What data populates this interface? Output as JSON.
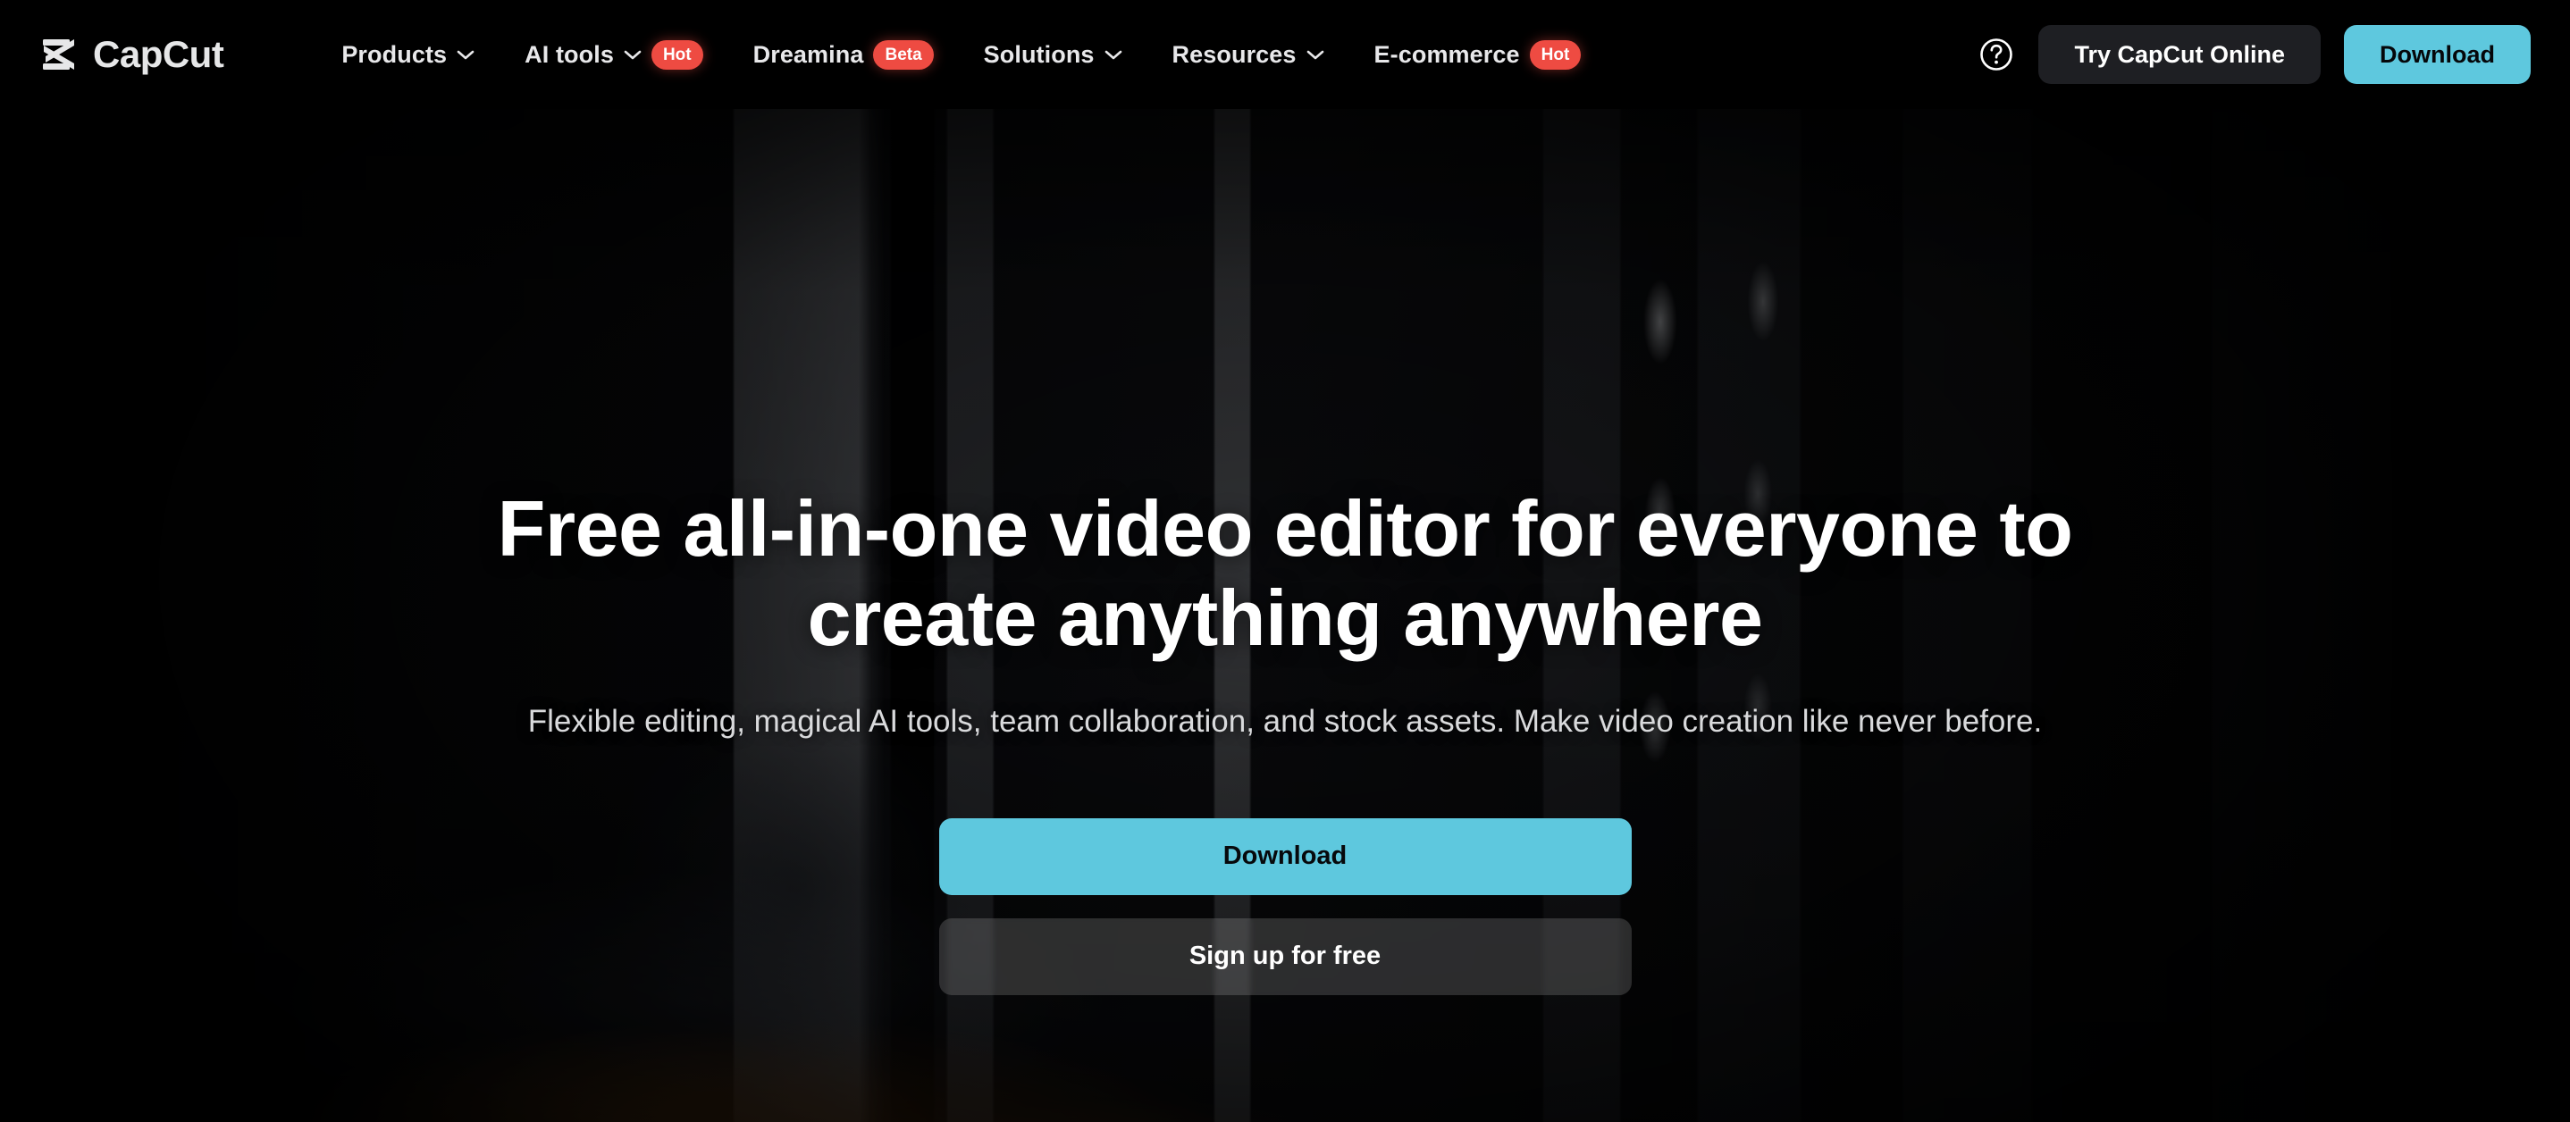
{
  "brand": {
    "name": "CapCut",
    "logo_icon": "capcut-logo-icon"
  },
  "nav": {
    "items": [
      {
        "label": "Products",
        "has_chevron": true,
        "chevron_icon": "chevron-down-icon",
        "badge": null
      },
      {
        "label": "AI tools",
        "has_chevron": true,
        "chevron_icon": "chevron-down-icon",
        "badge": "Hot"
      },
      {
        "label": "Dreamina",
        "has_chevron": false,
        "chevron_icon": "",
        "badge": "Beta"
      },
      {
        "label": "Solutions",
        "has_chevron": true,
        "chevron_icon": "chevron-down-icon",
        "badge": null
      },
      {
        "label": "Resources",
        "has_chevron": true,
        "chevron_icon": "chevron-down-icon",
        "badge": null
      },
      {
        "label": "E-commerce",
        "has_chevron": false,
        "chevron_icon": "",
        "badge": "Hot"
      }
    ],
    "help_icon": "help-circle-icon",
    "try_online_label": "Try CapCut Online",
    "download_label": "Download"
  },
  "hero": {
    "headline_line1": "Free all-in-one video editor for everyone to",
    "headline_line2": "create anything anywhere",
    "subheadline": "Flexible editing, magical AI tools, team collaboration, and stock assets. Make video creation like never before.",
    "primary_cta": "Download",
    "secondary_cta": "Sign up for free"
  },
  "colors": {
    "accent_cyan": "#5EC8DE",
    "badge_red": "#EE4B42",
    "nav_background": "#000000",
    "ghost_button": "#1E1F23",
    "text_primary": "#FFFFFF",
    "text_secondary": "#D9DADC"
  }
}
